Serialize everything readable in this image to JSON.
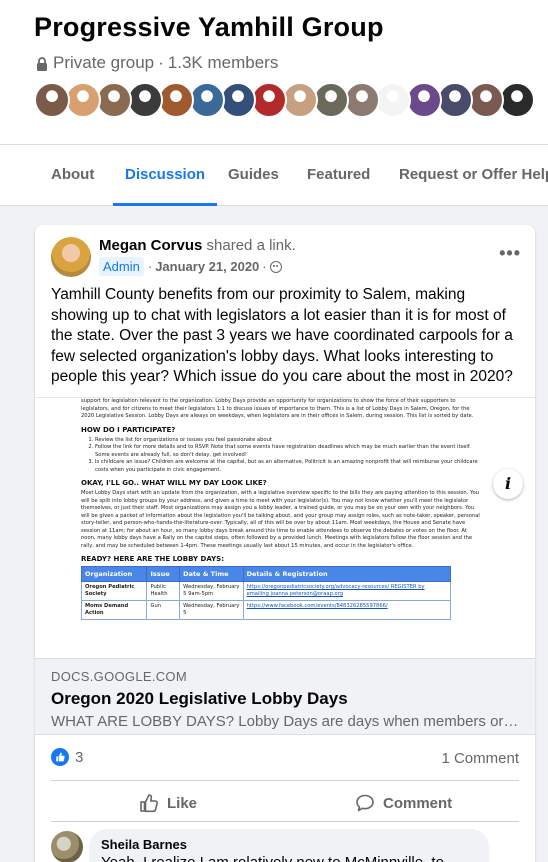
{
  "group": {
    "name": "Progressive Yamhill Group",
    "privacy": "Private group",
    "separator": "·",
    "members": "1.3K members",
    "member_avatar_colors": [
      "#7a5a48",
      "#d8a070",
      "#8a6a50",
      "#3b3b3b",
      "#a05a30",
      "#3a6a9a",
      "#34507a",
      "#b22a2a",
      "#c8a080",
      "#6a6a5a",
      "#8a7a70",
      "#f4f4f4",
      "#6a4a8a",
      "#4a4a6a",
      "#7a5a50",
      "#2a2a2a"
    ]
  },
  "tabs": [
    {
      "label": "About",
      "active": false
    },
    {
      "label": "Discussion",
      "active": true
    },
    {
      "label": "Guides",
      "active": false
    },
    {
      "label": "Featured",
      "active": false
    },
    {
      "label": "Request or Offer Help",
      "active": false
    }
  ],
  "post": {
    "author": "Megan Corvus",
    "action": "shared a link.",
    "badge": "Admin",
    "date": "January 21, 2020",
    "date_separator": "·",
    "more": "•••",
    "text": "Yamhill County benefits from our proximity to Salem, making showing up to chat with legislators a lot easier than it is for most of the state. Over the past 3 years we have coordinated carpools for a few selected organization's lobby days. What looks interesting to people this year? Which issue do you care about the most in 2020?"
  },
  "preview_doc": {
    "intro": "support for legislation relevant to the organization. Lobby Days provide an opportunity for organizations to show the force of their supporters to legislators, and for citizens to meet their legislators 1:1 to discuss issues of importance to them. This is a list of Lobby Days in Salem, Oregon, for the 2020 Legislative Session. Lobby Days are always on weekdays, when legislators are in their offices in Salem, during session. This list is sorted by date.",
    "h_participate": "HOW DO I PARTICIPATE?",
    "steps": [
      "Review the list for organizations or issues you feel passionate about",
      "Follow the link for more details and to RSVP. Note that some events have registration deadlines which may be much earlier than the event itself. Some events are already full, so don't delay, get involved!",
      "Is childcare an issue? Children are welcome at the capital, but as an alternative, Politricit is an amazing nonprofit that will reimburse your childcare costs when you participate in civic engagement."
    ],
    "h_day": "OKAY, I'LL GO.. WHAT WILL MY DAY LOOK LIKE?",
    "day_text": "Most Lobby Days start with an update from the organization, with a legislative overview specific to the bills they are paying attention to this session. You will be split into lobby groups by your address, and given a time to meet with your legislator(s). You may not know whether you'll meet the legislator themselves, or just their staff. Most organizations may assign you a lobby leader, a trained guide, or you may be on your own with your neighbors. You will be given a packet of information about the legislation you'll be talking about, and your group may assign roles, such as note-taker, speaker, personal story-teller, and person-who-hands-the-literature-over. Typically, all of this will be over by about 11am. Most weekdays, the House and Senate have session at 11am; for about an hour, so many lobby days break around this time to enable attendees to observe the debates or votes on the floor. At noon, many lobby days have a Rally on the capitol steps, often followed by a provided lunch. Meetings with legislators follow the floor session and the rally, and may be scheduled between 1-4pm. These meetings usually last about 15 minutes, and occur in the legislator's office.",
    "h_ready": "READY? HERE ARE THE LOBBY DAYS:",
    "table_headers": [
      "Organization",
      "Issue",
      "Date & Time",
      "Details & Registration"
    ],
    "table_rows": [
      [
        "Oregon Pediatric Society",
        "Public Health",
        "Wednesday, February 5 9am-5pm",
        "https://oregonpediatricsociety.org/advocacy-resources/ REGISTER by emailing joanna peterson@oraap.org"
      ],
      [
        "Moms Demand Action",
        "Gun",
        "Wednesday, February 5",
        "https://www.facebook.com/events/848326285597866/"
      ]
    ]
  },
  "link": {
    "domain": "DOCS.GOOGLE.COM",
    "title": "Oregon 2020 Legislative Lobby Days",
    "description": "WHAT ARE LOBBY DAYS? Lobby Days are days when members or s..."
  },
  "stats": {
    "likes": "3",
    "comments": "1 Comment"
  },
  "actions": {
    "like": "Like",
    "comment": "Comment"
  },
  "comment": {
    "author": "Sheila Barnes",
    "text": "Yeah, I realize I am relatively new to McMinnville, to"
  }
}
